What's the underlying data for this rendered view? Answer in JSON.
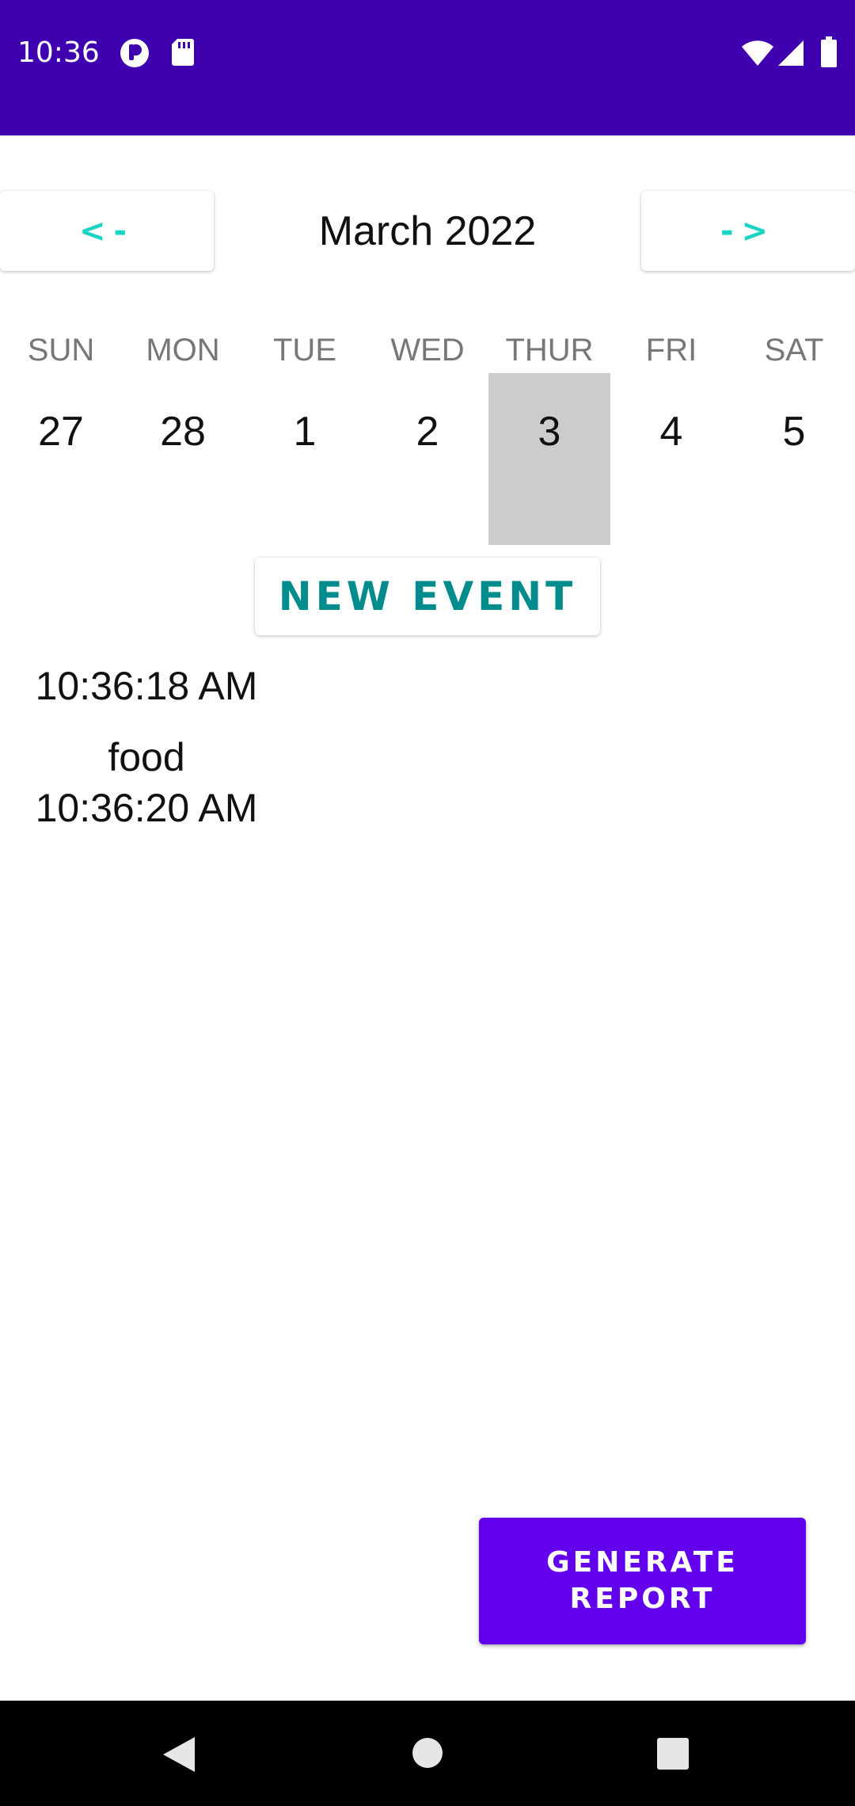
{
  "status_bar": {
    "time": "10:36",
    "icons": [
      "notification-icon",
      "sd-card-icon",
      "wifi-icon",
      "signal-icon",
      "battery-icon"
    ],
    "background_color": "#3F00B0"
  },
  "calendar": {
    "prev_label": "<-",
    "next_label": "->",
    "month_title": "March 2022",
    "days": [
      {
        "name": "SUN",
        "number": "27",
        "selected": false
      },
      {
        "name": "MON",
        "number": "28",
        "selected": false
      },
      {
        "name": "TUE",
        "number": "1",
        "selected": false
      },
      {
        "name": "WED",
        "number": "2",
        "selected": false
      },
      {
        "name": "THUR",
        "number": "3",
        "selected": true
      },
      {
        "name": "FRI",
        "number": "4",
        "selected": false
      },
      {
        "name": "SAT",
        "number": "5",
        "selected": false
      }
    ]
  },
  "actions": {
    "new_event_label": "NEW EVENT",
    "generate_report_label": "GENERATE REPORT"
  },
  "events": [
    {
      "text": "10:36:18 AM"
    },
    {
      "text": "food 10:36:20 AM"
    }
  ],
  "system_nav": {
    "icons": [
      "back-icon",
      "home-icon",
      "recents-icon"
    ]
  },
  "colors": {
    "accent_cyan": "#19D3C3",
    "teal_text": "#008C8C",
    "primary_button": "#6200EE",
    "selected_day": "#CCCCCC"
  }
}
